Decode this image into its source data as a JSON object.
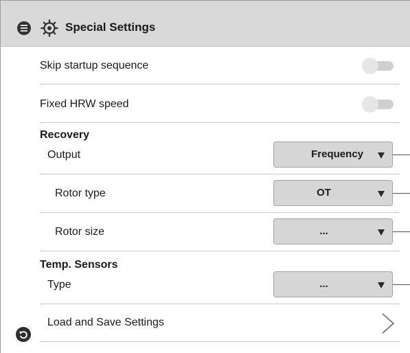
{
  "header": {
    "title": "Special Settings",
    "menu_icon": "menu-icon",
    "settings_icon": "gear-icon"
  },
  "toggles": [
    {
      "label": "Skip startup sequence",
      "state": "off"
    },
    {
      "label": "Fixed HRW speed",
      "state": "off"
    }
  ],
  "recovery": {
    "title": "Recovery",
    "output": {
      "label": "Output",
      "value": "Frequency"
    },
    "rotor_type": {
      "label": "Rotor type",
      "value": "OT"
    },
    "rotor_size": {
      "label": "Rotor size",
      "value": "..."
    }
  },
  "temp_sensors": {
    "title": "Temp. Sensors",
    "type": {
      "label": "Type",
      "value": "..."
    }
  },
  "load_save": {
    "label": "Load and Save Settings",
    "icon": "chevron-right-icon"
  },
  "footer": {
    "back_icon": "undo-icon"
  },
  "colors": {
    "header_bg": "#d9d9d9",
    "dropdown_bg": "#d6d6d6",
    "toggle_off": "#cfcfcf"
  }
}
